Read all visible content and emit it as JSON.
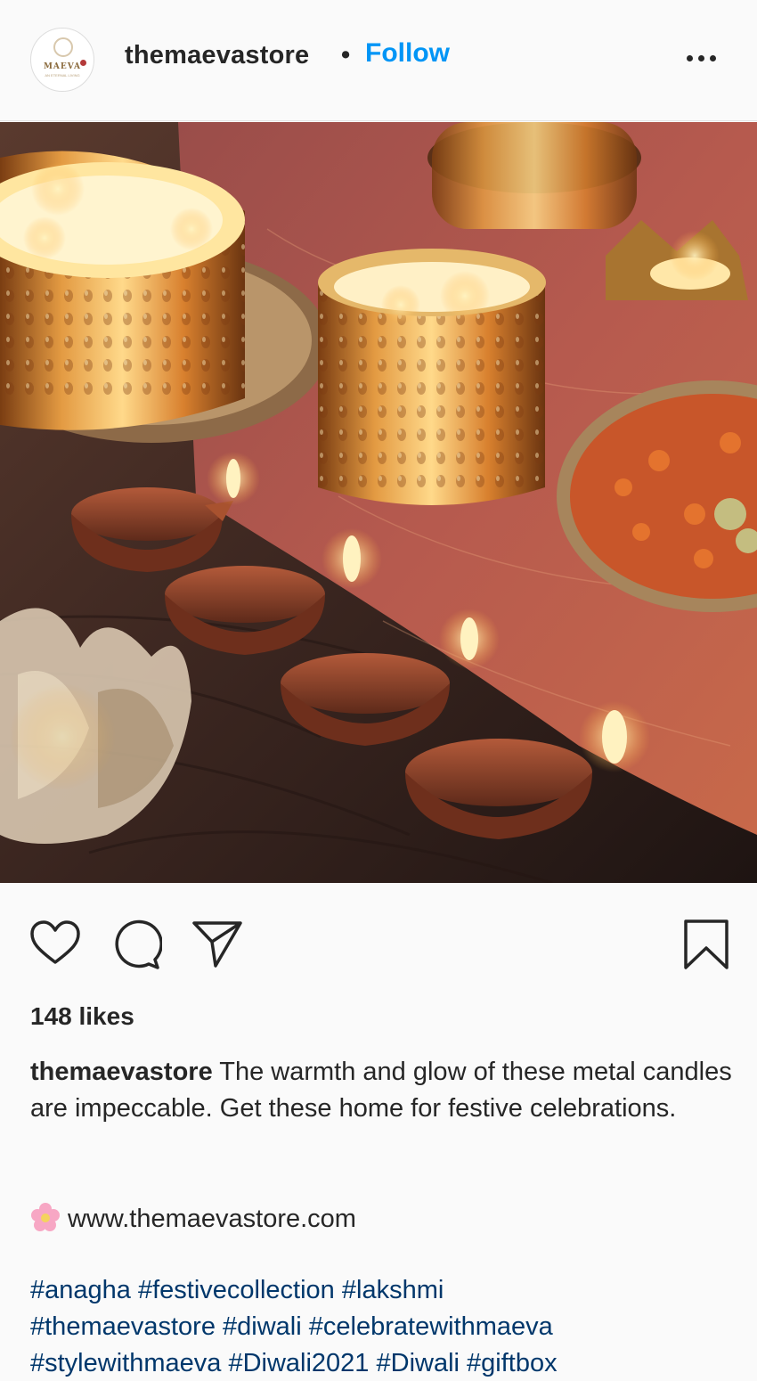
{
  "post": {
    "header": {
      "username": "themaevastore",
      "separator": "•",
      "follow_label": "Follow",
      "avatar_text": "MAEVA",
      "avatar_subtext": "AN ETERNAL LIVING"
    },
    "likes": "148 likes",
    "caption": {
      "username": "themaevastore",
      "text": "The warmth and glow of these metal candles are impeccable. Get these home for festive celebrations."
    },
    "website": "www.themaevastore.com",
    "hashtags": [
      "#anagha",
      "#festivecollection",
      "#lakshmi",
      "#themaevastore",
      "#diwali",
      "#celebratewithmaeva",
      "#stylewithmaeva",
      "#Diwali2021",
      "#Diwali",
      "#giftbox"
    ],
    "icons": {
      "more": "more-options-icon",
      "like": "heart-icon",
      "comment": "comment-icon",
      "share": "send-icon",
      "save": "bookmark-icon",
      "website": "flower-emoji-icon"
    },
    "colors": {
      "link": "#0095f6",
      "hashtag": "#00376b",
      "text": "#262626",
      "background": "#fafafa"
    }
  }
}
